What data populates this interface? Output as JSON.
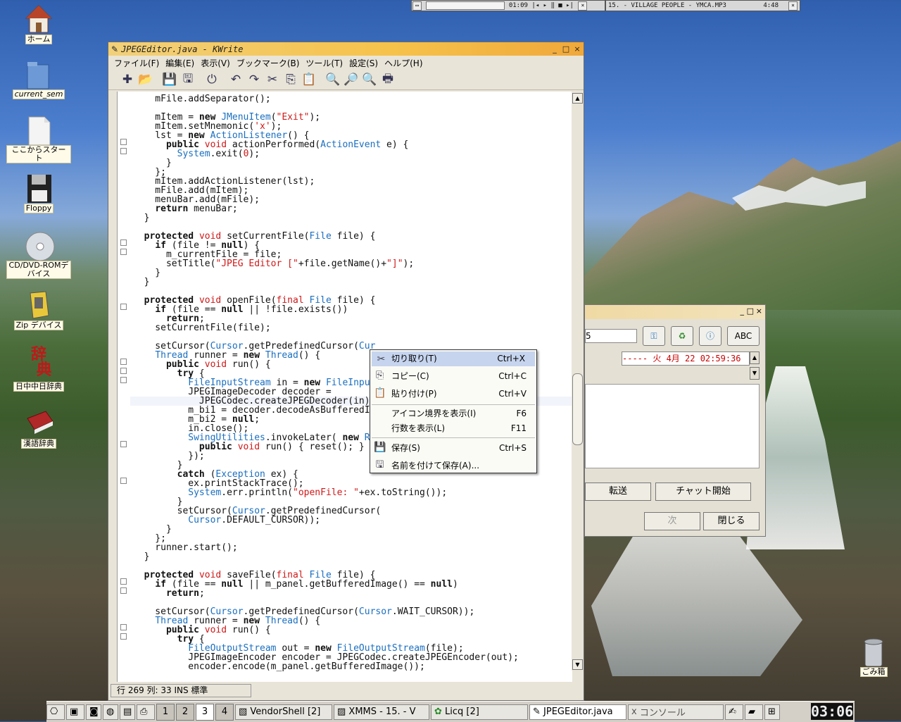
{
  "desktop_icons": [
    {
      "label": "ホーム",
      "icon": "home-icon"
    },
    {
      "label": "current_sem",
      "icon": "folder-icon"
    },
    {
      "label": "ここからスタート",
      "icon": "document-icon"
    },
    {
      "label": "Floppy",
      "icon": "floppy-icon"
    },
    {
      "label": "CD/DVD-ROMデバイス",
      "icon": "cdrom-icon"
    },
    {
      "label": "Zip デバイス",
      "icon": "zip-icon"
    },
    {
      "label": "日中中日辞典",
      "icon": "dictionary-icon"
    },
    {
      "label": "漢語辞典",
      "icon": "book-icon"
    },
    {
      "label": "ごみ箱",
      "icon": "trash-icon"
    }
  ],
  "xmms_bar": {
    "time": "01:09"
  },
  "xmms_title": {
    "track": "15.  - VILLAGE PEOPLE - YMCA.MP3",
    "duration": "4:48"
  },
  "window": {
    "title": "JPEGEditor.java - KWrite",
    "menu": [
      "ファイル(F)",
      "編集(E)",
      "表示(V)",
      "ブックマーク(B)",
      "ツール(T)",
      "設定(S)",
      "ヘルプ(H)"
    ],
    "status": "行 269 列: 33  INS  標準"
  },
  "context_menu": {
    "items": [
      {
        "label": "切り取り(T)",
        "shortcut": "Ctrl+X",
        "icon": "scissors-icon"
      },
      {
        "label": "コピー(C)",
        "shortcut": "Ctrl+C",
        "icon": "copy-icon"
      },
      {
        "label": "貼り付け(P)",
        "shortcut": "Ctrl+V",
        "icon": "paste-icon"
      },
      {
        "label": "アイコン境界を表示(I)",
        "shortcut": "F6",
        "icon": ""
      },
      {
        "label": "行数を表示(L)",
        "shortcut": "F11",
        "icon": ""
      },
      {
        "label": "保存(S)",
        "shortcut": "Ctrl+S",
        "icon": "save-icon"
      },
      {
        "label": "名前を付けて保存(A)...",
        "shortcut": "",
        "icon": "save-as-icon"
      }
    ]
  },
  "chat": {
    "input_value": "5",
    "time": "-----  火  4月 22 02:59:36",
    "buttons": {
      "forward": "転送",
      "start_chat": "チャット開始",
      "next": "次",
      "close": "閉じる",
      "abc": "ABC"
    }
  },
  "taskbar": {
    "desktops": [
      "1",
      "2",
      "3",
      "4"
    ],
    "tasks": [
      "VendorShell [2]",
      "XMMS - 15. - V",
      "Licq [2]",
      "JPEGEditor.java",
      "コンソール"
    ],
    "clock": "03:06"
  },
  "code_lines": [
    [
      [
        "    mFile.addSeparator();",
        ""
      ]
    ],
    [
      [
        "",
        ""
      ]
    ],
    [
      [
        "    mItem = ",
        ""
      ],
      [
        "new",
        "kw"
      ],
      [
        " ",
        ""
      ],
      [
        "JMenuItem",
        "ty"
      ],
      [
        "(",
        ""
      ],
      [
        "\"Exit\"",
        "st"
      ],
      [
        ");",
        ""
      ]
    ],
    [
      [
        "    mItem.setMnemonic(",
        ""
      ],
      [
        "'x'",
        "st"
      ],
      [
        ");",
        ""
      ]
    ],
    [
      [
        "    lst = ",
        ""
      ],
      [
        "new",
        "kw"
      ],
      [
        " ",
        ""
      ],
      [
        "ActionListener",
        "ty"
      ],
      [
        "() {",
        ""
      ]
    ],
    [
      [
        "      ",
        ""
      ],
      [
        "public",
        "kw"
      ],
      [
        " ",
        ""
      ],
      [
        "void",
        "st"
      ],
      [
        " actionPerformed(",
        ""
      ],
      [
        "ActionEvent",
        "ty"
      ],
      [
        " e) {",
        ""
      ]
    ],
    [
      [
        "        ",
        ""
      ],
      [
        "System",
        "ty"
      ],
      [
        ".exit(",
        ""
      ],
      [
        "0",
        "st"
      ],
      [
        ");",
        ""
      ]
    ],
    [
      [
        "      }",
        ""
      ]
    ],
    [
      [
        "    };",
        ""
      ]
    ],
    [
      [
        "    mItem.addActionListener(lst);",
        ""
      ]
    ],
    [
      [
        "    mFile.add(mItem);",
        ""
      ]
    ],
    [
      [
        "    menuBar.add(mFile);",
        ""
      ]
    ],
    [
      [
        "    ",
        ""
      ],
      [
        "return",
        "kw"
      ],
      [
        " menuBar;",
        ""
      ]
    ],
    [
      [
        "  }",
        ""
      ]
    ],
    [
      [
        "",
        ""
      ]
    ],
    [
      [
        "  ",
        ""
      ],
      [
        "protected",
        "kw"
      ],
      [
        " ",
        ""
      ],
      [
        "void",
        "st"
      ],
      [
        " setCurrentFile(",
        ""
      ],
      [
        "File",
        "ty"
      ],
      [
        " file) {",
        ""
      ]
    ],
    [
      [
        "    ",
        ""
      ],
      [
        "if",
        "kw"
      ],
      [
        " (file != ",
        ""
      ],
      [
        "null",
        "kw"
      ],
      [
        ") {",
        ""
      ]
    ],
    [
      [
        "      m_currentFile = file;",
        ""
      ]
    ],
    [
      [
        "      setTitle(",
        ""
      ],
      [
        "\"JPEG Editor [\"",
        "st"
      ],
      [
        "+file.getName()+",
        ""
      ],
      [
        "\"]\"",
        "st"
      ],
      [
        ");",
        ""
      ]
    ],
    [
      [
        "    }",
        ""
      ]
    ],
    [
      [
        "  }",
        ""
      ]
    ],
    [
      [
        "",
        ""
      ]
    ],
    [
      [
        "  ",
        ""
      ],
      [
        "protected",
        "kw"
      ],
      [
        " ",
        ""
      ],
      [
        "void",
        "st"
      ],
      [
        " openFile(",
        ""
      ],
      [
        "final",
        "st"
      ],
      [
        " ",
        ""
      ],
      [
        "File",
        "ty"
      ],
      [
        " file) {",
        ""
      ]
    ],
    [
      [
        "    ",
        ""
      ],
      [
        "if",
        "kw"
      ],
      [
        " (file == ",
        ""
      ],
      [
        "null",
        "kw"
      ],
      [
        " || !file.exists())",
        ""
      ]
    ],
    [
      [
        "      ",
        ""
      ],
      [
        "return",
        "kw"
      ],
      [
        ";",
        ""
      ]
    ],
    [
      [
        "    setCurrentFile(file);",
        ""
      ]
    ],
    [
      [
        "",
        ""
      ]
    ],
    [
      [
        "    setCursor(",
        ""
      ],
      [
        "Cursor",
        "ty"
      ],
      [
        ".getPredefinedCursor(",
        ""
      ],
      [
        "Cur",
        "ty"
      ]
    ],
    [
      [
        "    ",
        ""
      ],
      [
        "Thread",
        "ty"
      ],
      [
        " runner = ",
        ""
      ],
      [
        "new",
        "kw"
      ],
      [
        " ",
        ""
      ],
      [
        "Thread",
        "ty"
      ],
      [
        "() {",
        ""
      ]
    ],
    [
      [
        "      ",
        ""
      ],
      [
        "public",
        "kw"
      ],
      [
        " ",
        ""
      ],
      [
        "void",
        "st"
      ],
      [
        " run() {",
        ""
      ]
    ],
    [
      [
        "        ",
        ""
      ],
      [
        "try",
        "kw"
      ],
      [
        " {",
        ""
      ]
    ],
    [
      [
        "          ",
        ""
      ],
      [
        "FileInputStream",
        "ty"
      ],
      [
        " in = ",
        ""
      ],
      [
        "new",
        "kw"
      ],
      [
        " ",
        ""
      ],
      [
        "FileInput",
        "ty"
      ]
    ],
    [
      [
        "          JPEGImageDecoder decoder =",
        ""
      ]
    ],
    [
      [
        "            JPEGCodec.createJPEGDecoder(in);",
        ""
      ]
    ],
    [
      [
        "          m_bi1 = decoder.decodeAsBufferedIm",
        ""
      ]
    ],
    [
      [
        "          m_bi2 = ",
        ""
      ],
      [
        "null",
        "kw"
      ],
      [
        ";",
        ""
      ]
    ],
    [
      [
        "          in.close();",
        ""
      ]
    ],
    [
      [
        "          ",
        ""
      ],
      [
        "SwingUtilities",
        "ty"
      ],
      [
        ".invokeLater( ",
        ""
      ],
      [
        "new",
        "kw"
      ],
      [
        " ",
        ""
      ],
      [
        "Ru",
        "ty"
      ]
    ],
    [
      [
        "            ",
        ""
      ],
      [
        "public",
        "kw"
      ],
      [
        " ",
        ""
      ],
      [
        "void",
        "st"
      ],
      [
        " run() { reset(); }",
        ""
      ]
    ],
    [
      [
        "          });",
        ""
      ]
    ],
    [
      [
        "        }",
        ""
      ]
    ],
    [
      [
        "        ",
        ""
      ],
      [
        "catch",
        "kw"
      ],
      [
        " (",
        ""
      ],
      [
        "Exception",
        "ty"
      ],
      [
        " ex) {",
        ""
      ]
    ],
    [
      [
        "          ex.printStackTrace();",
        ""
      ]
    ],
    [
      [
        "          ",
        ""
      ],
      [
        "System",
        "ty"
      ],
      [
        ".err.println(",
        ""
      ],
      [
        "\"openFile: \"",
        "st"
      ],
      [
        "+ex.toString());",
        ""
      ]
    ],
    [
      [
        "        }",
        ""
      ]
    ],
    [
      [
        "        setCursor(",
        ""
      ],
      [
        "Cursor",
        "ty"
      ],
      [
        ".getPredefinedCursor(",
        ""
      ]
    ],
    [
      [
        "          ",
        ""
      ],
      [
        "Cursor",
        "ty"
      ],
      [
        ".DEFAULT_CURSOR));",
        ""
      ]
    ],
    [
      [
        "      }",
        ""
      ]
    ],
    [
      [
        "    };",
        ""
      ]
    ],
    [
      [
        "    runner.start();",
        ""
      ]
    ],
    [
      [
        "  }",
        ""
      ]
    ],
    [
      [
        "",
        ""
      ]
    ],
    [
      [
        "  ",
        ""
      ],
      [
        "protected",
        "kw"
      ],
      [
        " ",
        ""
      ],
      [
        "void",
        "st"
      ],
      [
        " saveFile(",
        ""
      ],
      [
        "final",
        "st"
      ],
      [
        " ",
        ""
      ],
      [
        "File",
        "ty"
      ],
      [
        " file) {",
        ""
      ]
    ],
    [
      [
        "    ",
        ""
      ],
      [
        "if",
        "kw"
      ],
      [
        " (file == ",
        ""
      ],
      [
        "null",
        "kw"
      ],
      [
        " || m_panel.getBufferedImage() == ",
        ""
      ],
      [
        "null",
        "kw"
      ],
      [
        ")",
        ""
      ]
    ],
    [
      [
        "      ",
        ""
      ],
      [
        "return",
        "kw"
      ],
      [
        ";",
        ""
      ]
    ],
    [
      [
        "",
        ""
      ]
    ],
    [
      [
        "    setCursor(",
        ""
      ],
      [
        "Cursor",
        "ty"
      ],
      [
        ".getPredefinedCursor(",
        ""
      ],
      [
        "Cursor",
        "ty"
      ],
      [
        ".WAIT_CURSOR));",
        ""
      ]
    ],
    [
      [
        "    ",
        ""
      ],
      [
        "Thread",
        "ty"
      ],
      [
        " runner = ",
        ""
      ],
      [
        "new",
        "kw"
      ],
      [
        " ",
        ""
      ],
      [
        "Thread",
        "ty"
      ],
      [
        "() {",
        ""
      ]
    ],
    [
      [
        "      ",
        ""
      ],
      [
        "public",
        "kw"
      ],
      [
        " ",
        ""
      ],
      [
        "void",
        "st"
      ],
      [
        " run() {",
        ""
      ]
    ],
    [
      [
        "        ",
        ""
      ],
      [
        "try",
        "kw"
      ],
      [
        " {",
        ""
      ]
    ],
    [
      [
        "          ",
        ""
      ],
      [
        "FileOutputStream",
        "ty"
      ],
      [
        " out = ",
        ""
      ],
      [
        "new",
        "kw"
      ],
      [
        " ",
        ""
      ],
      [
        "FileOutputStream",
        "ty"
      ],
      [
        "(file);",
        ""
      ]
    ],
    [
      [
        "          JPEGImageEncoder encoder = JPEGCodec.createJPEGEncoder(out);",
        ""
      ]
    ],
    [
      [
        "          encoder.encode(m_panel.getBufferedImage());",
        ""
      ]
    ]
  ]
}
